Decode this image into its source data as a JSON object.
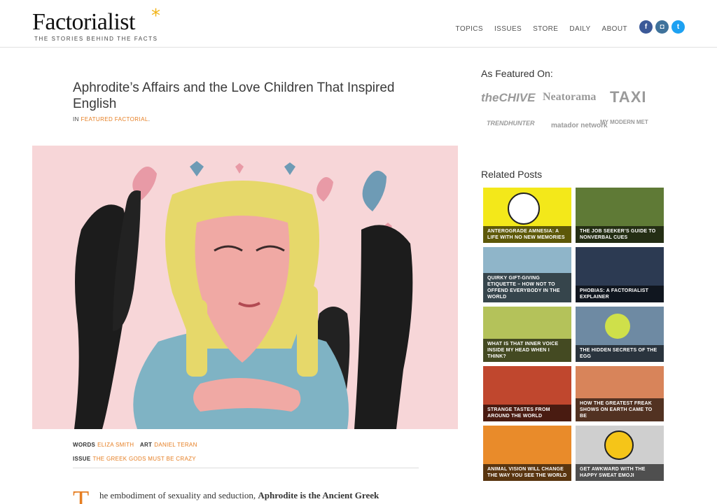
{
  "brand": {
    "name": "Factorialist",
    "star": "*",
    "tagline": "THE STORIES BEHIND THE FACTS"
  },
  "nav": {
    "items": [
      "TOPICS",
      "ISSUES",
      "STORE",
      "DAILY",
      "ABOUT"
    ]
  },
  "social": [
    {
      "icon": "facebook-icon",
      "glyph": "f",
      "color": "#3b5998"
    },
    {
      "icon": "instagram-icon",
      "glyph": "◘",
      "color": "#3f729b"
    },
    {
      "icon": "twitter-icon",
      "glyph": "t",
      "color": "#1da1f2"
    }
  ],
  "article": {
    "title": "Aphrodite’s Affairs and the Love Children That Inspired English",
    "category_prefix": "IN",
    "category": "FEATURED FACTORIAL",
    "category_suffix": ".",
    "words_label": "WORDS",
    "author": "ELIZA SMITH",
    "art_label": "ART",
    "artist": "DANIEL TERAN",
    "issue_label": "ISSUE",
    "issue": "THE GREEK GODS MUST BE CRAZY",
    "dropcap": "T",
    "lead_text": "he embodiment of sexuality and seduction,",
    "lead_bold": "Aphrodite is the Ancient Greek"
  },
  "sidebar": {
    "featured_heading": "As Featured On:",
    "featured_logos": [
      "theCHIVE",
      "Neatorama",
      "TAXI",
      "TRENDHUNTER",
      "matador network",
      "MY MODERN MET"
    ],
    "related_heading": "Related Posts",
    "posts": [
      {
        "title": "ANTEROGRADE AMNESIA: A LIFE WITH NO NEW MEMORIES",
        "bg": "#f3e81a"
      },
      {
        "title": "THE JOB SEEKER’S GUIDE TO NONVERBAL CUES",
        "bg": "#5f7a36"
      },
      {
        "title": "QUIRKY GIFT-GIVING ETIQUETTE – HOW NOT TO OFFEND EVERYBODY IN THE WORLD",
        "bg": "#8fb5c9"
      },
      {
        "title": "PHOBIAS: A FACTORIALIST EXPLAINER",
        "bg": "#2c3a52"
      },
      {
        "title": "WHAT IS THAT INNER VOICE INSIDE MY HEAD WHEN I THINK?",
        "bg": "#b4c25a"
      },
      {
        "title": "THE HIDDEN SECRETS OF THE EGG",
        "bg": "#6e8aa3"
      },
      {
        "title": "STRANGE TASTES FROM AROUND THE WORLD",
        "bg": "#c0472e"
      },
      {
        "title": "HOW THE GREATEST FREAK SHOWS ON EARTH CAME TO BE",
        "bg": "#d8845a"
      },
      {
        "title": "ANIMAL VISION WILL CHANGE THE WAY YOU SEE THE WORLD",
        "bg": "#e98b2a"
      },
      {
        "title": "GET AWKWARD WITH THE HAPPY SWEAT EMOJI",
        "bg": "#cfcfcf"
      }
    ]
  }
}
